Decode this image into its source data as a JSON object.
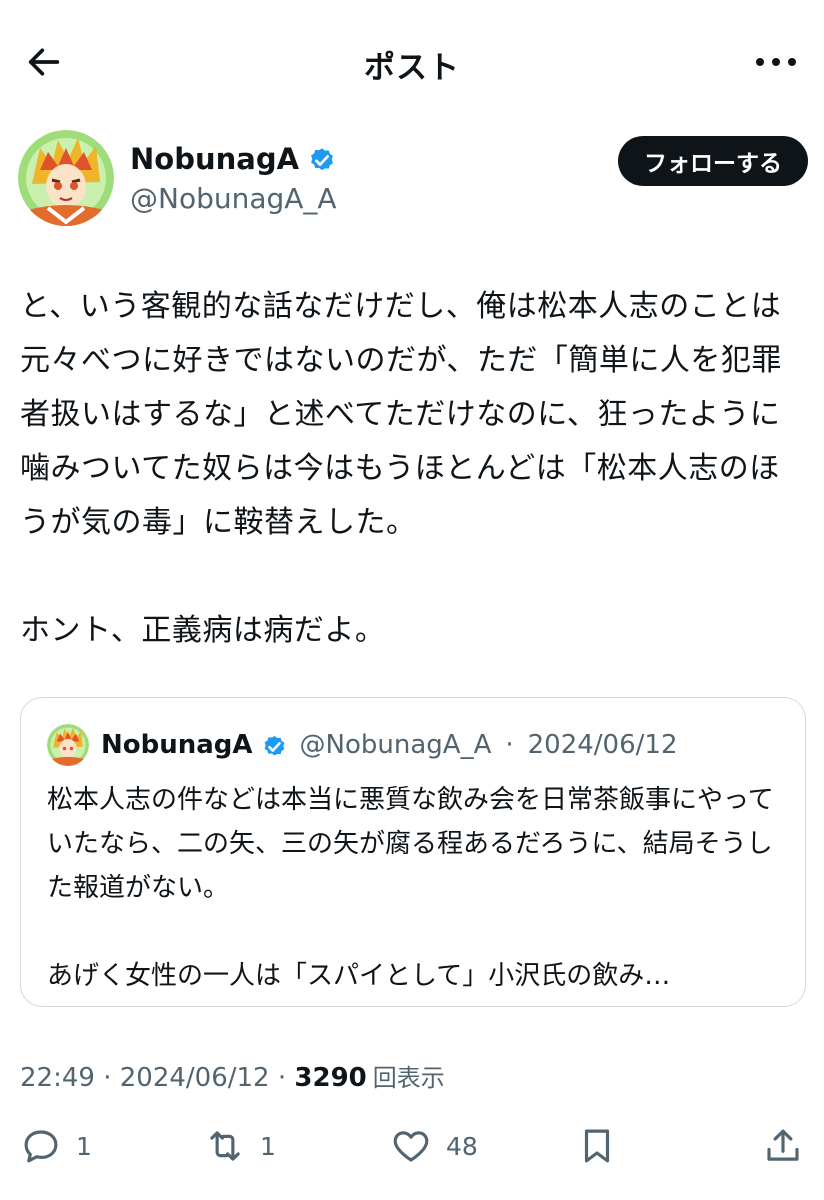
{
  "header": {
    "title": "ポスト",
    "back_icon": "arrow-left-icon",
    "more_icon": "more-horizontal-icon"
  },
  "author": {
    "name": "NobunagA",
    "handle": "@NobunagA_A",
    "verified": true,
    "follow_label": "フォローする"
  },
  "post": {
    "text": "と、いう客観的な話なだけだし、俺は松本人志のことは元々べつに好きではないのだが、ただ「簡単に人を犯罪者扱いはするな」と述べてただけなのに、狂ったように噛みついてた奴らは今はもうほとんどは「松本人志のほうが気の毒」に鞍替えした。\n\nホント、正義病は病だよ。"
  },
  "quote": {
    "name": "NobunagA",
    "handle": "@NobunagA_A",
    "separator": "·",
    "date": "2024/06/12",
    "text": "松本人志の件などは本当に悪質な飲み会を日常茶飯事にやっていたなら、二の矢、三の矢が腐る程あるだろうに、結局そうした報道がない。\n\nあげく女性の一人は「スパイとして」小沢氏の飲み…"
  },
  "meta": {
    "time": "22:49",
    "sep1": " · ",
    "date": "2024/06/12",
    "sep2": " · ",
    "views": "3290",
    "views_label": "回表示"
  },
  "actions": {
    "replies": "1",
    "reposts": "1",
    "likes": "48"
  },
  "colors": {
    "text": "#0f1419",
    "secondary": "#536471",
    "verified": "#1d9bf0",
    "border": "#cfd9de"
  }
}
